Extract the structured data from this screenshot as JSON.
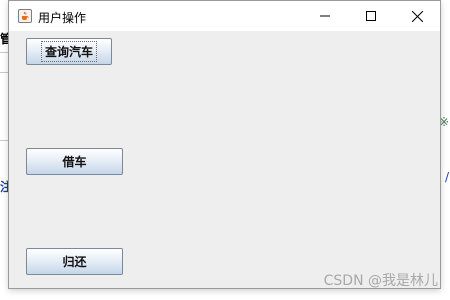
{
  "window": {
    "title": "用户操作",
    "app_icon": "java-coffee-cup-icon",
    "controls": [
      "minimize-icon",
      "maximize-icon",
      "close-icon"
    ]
  },
  "buttons": {
    "query_cars": "查询汽车",
    "borrow_car": "借车",
    "return_car": "归还"
  },
  "background": {
    "top_left_fragment": "管",
    "left_blue_fragment": "注",
    "right_green_fragment": "※",
    "right_blue_fragment": "/"
  },
  "watermark": "CSDN @我是林儿",
  "colors": {
    "client_bg": "#eeeeee",
    "button_top": "#ffffff",
    "button_bottom": "#c5d6e8",
    "button_border": "#7a8a99"
  }
}
